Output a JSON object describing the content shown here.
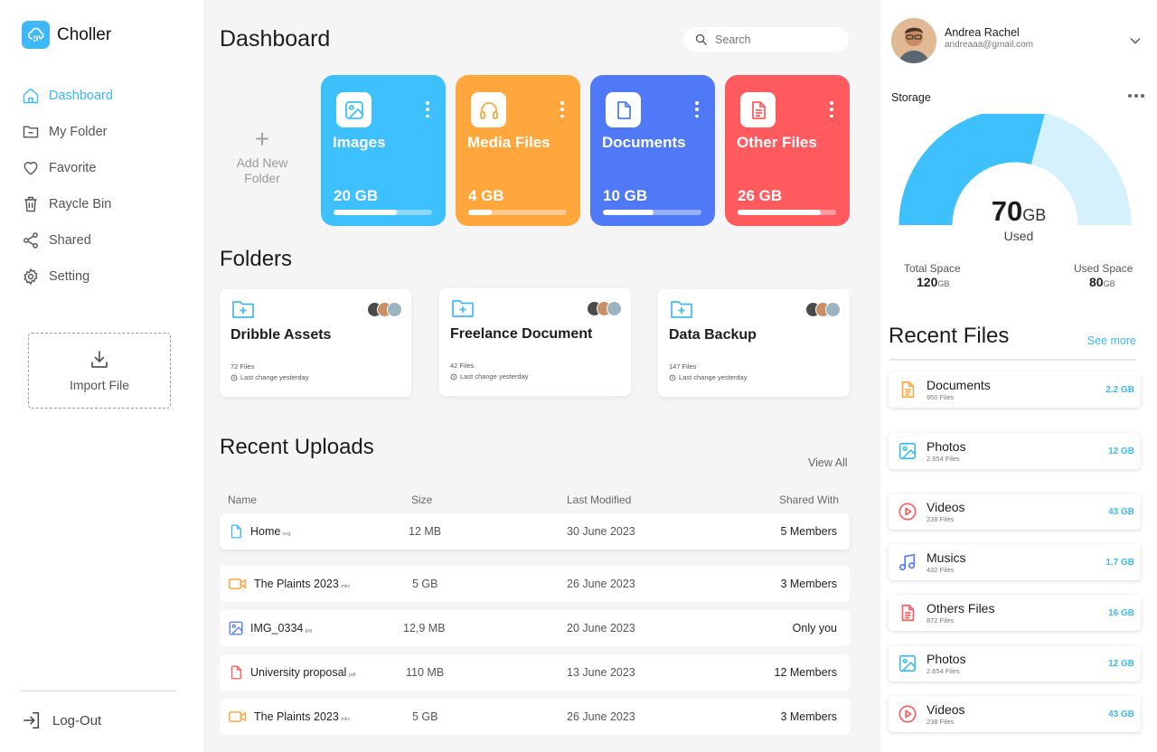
{
  "brand": {
    "name": "Choller"
  },
  "sidebar": {
    "items": [
      {
        "label": "Dashboard",
        "icon": "home-icon"
      },
      {
        "label": "My Folder",
        "icon": "folder-icon"
      },
      {
        "label": "Favorite",
        "icon": "heart-icon"
      },
      {
        "label": "Raycle Bin",
        "icon": "trash-icon"
      },
      {
        "label": "Shared",
        "icon": "share-icon"
      },
      {
        "label": "Setting",
        "icon": "gear-icon"
      }
    ],
    "import_label": "Import File",
    "logout_label": "Log-Out"
  },
  "header": {
    "title": "Dashboard",
    "search_placeholder": "Search"
  },
  "add_new": {
    "label_line1": "Add New",
    "label_line2": "Folder"
  },
  "categories": [
    {
      "name": "Images",
      "size": "20 GB",
      "usage": 0.64,
      "color": "#3ec0fc",
      "icon": "image-icon"
    },
    {
      "name": "Media Files",
      "size": "4 GB",
      "usage": 0.24,
      "color": "#ffa63d",
      "icon": "headphones-icon"
    },
    {
      "name": "Documents",
      "size": "10 GB",
      "usage": 0.51,
      "color": "#4f79f7",
      "icon": "document-icon"
    },
    {
      "name": "Other Files",
      "size": "26 GB",
      "usage": 0.84,
      "color": "#ff5b5f",
      "icon": "file-text-icon"
    }
  ],
  "folders_section": {
    "title": "Folders"
  },
  "folders": [
    {
      "name": "Dribble Assets",
      "count": "72 Files",
      "changed": "Last change yesterday"
    },
    {
      "name": "Freelance Document",
      "count": "42 Files",
      "changed": "Last change yesterday"
    },
    {
      "name": "Data Backup",
      "count": "147 Files",
      "changed": "Last change yesterday"
    }
  ],
  "uploads_section": {
    "title": "Recent Uploads",
    "view_all": "View All",
    "columns": [
      "Name",
      "Size",
      "Last Modified",
      "Shared With"
    ]
  },
  "uploads": [
    {
      "name": "Home",
      "ext": ".svg",
      "size": "12 MB",
      "date": "30 June 2023",
      "shared": "5 Members",
      "icon": "file-icon",
      "color": "#3eb9f7"
    },
    {
      "name": "The Plaints 2023",
      "ext": ".mkv",
      "size": "5 GB",
      "date": "26 June 2023",
      "shared": "3 Members",
      "icon": "video-icon",
      "color": "#ffa63d"
    },
    {
      "name": "IMG_0334",
      "ext": ".jpg",
      "size": "12,9 MB",
      "date": "20 June 2023",
      "shared": "Only you",
      "icon": "image-icon",
      "color": "#4f79f7"
    },
    {
      "name": "University proposal",
      "ext": ".pdf",
      "size": "110 MB",
      "date": "13 June 2023",
      "shared": "12 Members",
      "icon": "file-icon",
      "color": "#ff5b5f"
    },
    {
      "name": "The Plaints 2023",
      "ext": ".mkv",
      "size": "5 GB",
      "date": "26 June 2023",
      "shared": "3 Members",
      "icon": "video-icon",
      "color": "#ffa63d"
    }
  ],
  "profile": {
    "name": "Andrea Rachel",
    "email": "andreaaa@gmail.com"
  },
  "storage": {
    "title": "Storage",
    "used_value": "70",
    "used_unit": "GB",
    "used_label": "Used",
    "used_fraction": 0.583,
    "total_label": "Total Space",
    "total_value": "120",
    "total_unit": "GB",
    "used_space_label": "Used Space",
    "used_space_value": "80",
    "used_space_unit": "GB",
    "color_used": "#3ec0fc",
    "color_free": "#d6f1fe"
  },
  "recent": {
    "title": "Recent Files",
    "see_more": "See more",
    "items": [
      {
        "name": "Documents",
        "count": "950 Files",
        "size": "2.2 GB",
        "icon": "document-icon",
        "color": "#ffa63d"
      },
      {
        "name": "Photos",
        "count": "2.654 Files",
        "size": "12 GB",
        "icon": "image-icon",
        "color": "#3eb9f7"
      },
      {
        "name": "Videos",
        "count": "238 Files",
        "size": "43 GB",
        "icon": "play-icon",
        "color": "#ff5b5f"
      },
      {
        "name": "Musics",
        "count": "432 Files",
        "size": "1.7 GB",
        "icon": "music-icon",
        "color": "#4f79f7"
      },
      {
        "name": "Others Files",
        "count": "872 Files",
        "size": "16 GB",
        "icon": "file-text-icon",
        "color": "#ff5b5f"
      },
      {
        "name": "Photos",
        "count": "2.654 Files",
        "size": "12 GB",
        "icon": "image-icon",
        "color": "#3eb9f7"
      },
      {
        "name": "Videos",
        "count": "238 Files",
        "size": "43 GB",
        "icon": "play-icon",
        "color": "#ff5b5f"
      }
    ]
  }
}
